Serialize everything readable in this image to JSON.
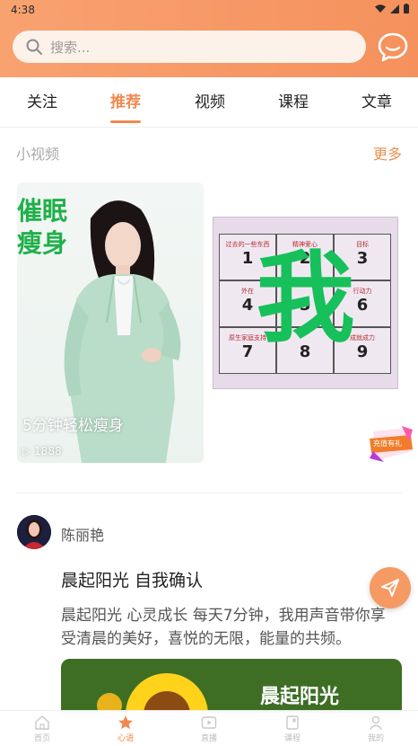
{
  "status_bar": {
    "time": "4:38"
  },
  "header": {
    "search_placeholder": "搜索..."
  },
  "tabs": [
    {
      "label": "关注"
    },
    {
      "label": "推荐",
      "active": true
    },
    {
      "label": "视频"
    },
    {
      "label": "课程"
    },
    {
      "label": "文章"
    }
  ],
  "small_video": {
    "title": "小视频",
    "more": "更多",
    "cards": [
      {
        "overlay_text_line1": "催眠",
        "overlay_text_line2": "瘦身",
        "caption": "5分钟轻松瘦身",
        "views": "1888"
      },
      {
        "big_char": "我",
        "cells": [
          {
            "label": "过去的一些东西",
            "num": "1"
          },
          {
            "label": "精神爱心",
            "num": "2"
          },
          {
            "label": "目标",
            "num": "3"
          },
          {
            "label": "外在",
            "num": "4"
          },
          {
            "label": "",
            "num": "5"
          },
          {
            "label": "行动力",
            "num": "6"
          },
          {
            "label": "原生家庭支持",
            "num": "7"
          },
          {
            "label": "",
            "num": "8"
          },
          {
            "label": "成就成力",
            "num": "9"
          }
        ]
      }
    ],
    "promo_badge": "充值有礼"
  },
  "post": {
    "author": "陈丽艳",
    "title": "晨起阳光 自我确认",
    "body": "晨起阳光 心灵成长 每天7分钟，我用声音带你享受清晨的美好，喜悦的无限，能量的共频。",
    "image_text": "晨起阳光"
  },
  "bottom_nav": [
    {
      "label": "首页"
    },
    {
      "label": "心语",
      "active": true
    },
    {
      "label": "直播"
    },
    {
      "label": "课程"
    },
    {
      "label": "我的"
    }
  ],
  "colors": {
    "accent": "#f0894f",
    "header_gradient_start": "#f8a270",
    "header_gradient_end": "#f5915d",
    "overlay_green": "#1fb04a"
  }
}
